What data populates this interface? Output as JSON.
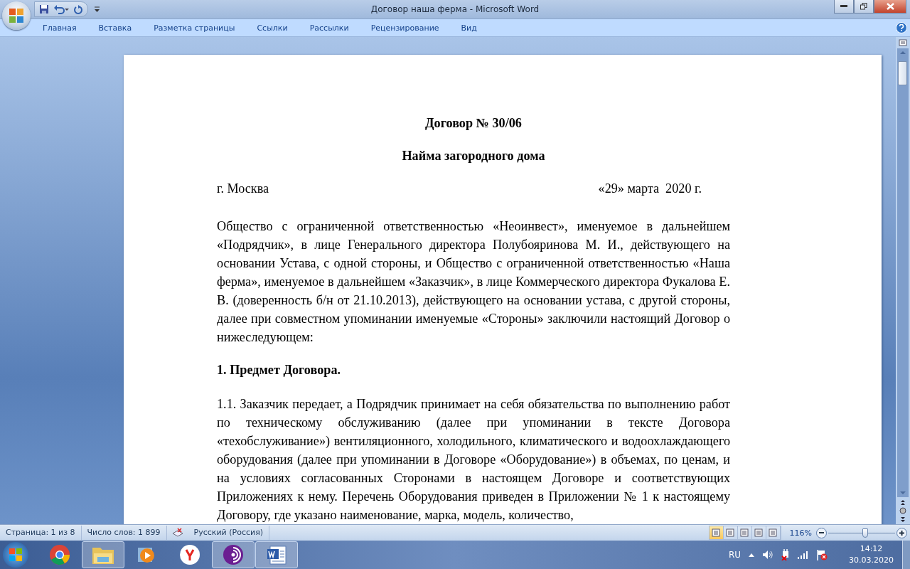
{
  "window": {
    "title": "Договор наша ферма - Microsoft Word"
  },
  "ribbon_tabs": [
    {
      "label": "Главная",
      "selected": false
    },
    {
      "label": "Вставка",
      "selected": false
    },
    {
      "label": "Разметка страницы",
      "selected": false
    },
    {
      "label": "Ссылки",
      "selected": false
    },
    {
      "label": "Рассылки",
      "selected": false
    },
    {
      "label": "Рецензирование",
      "selected": false
    },
    {
      "label": "Вид",
      "selected": false
    }
  ],
  "document": {
    "blocks": [
      {
        "kind": "title",
        "text": "Договор № 30/06"
      },
      {
        "kind": "title",
        "text": "Найма загородного дома"
      },
      {
        "kind": "dateline",
        "left": "г. Москва",
        "right": "«29» марта  2020 г."
      },
      {
        "kind": "paragraph",
        "text": "Общество с ограниченной ответственностью «Неоинвест», именуемое в дальнейшем «Подрядчик», в лице Генерального директора Полубояринова М. И., действующего на основании Устава, с одной стороны, и Общество с ограниченной ответственностью «Наша ферма», именуемое в дальнейшем «Заказчик», в лице Коммерческого директора Фукалова Е. В. (доверенность б/н от 21.10.2013), действующего на основании устава, с другой стороны, далее при совместном упоминании именуемые «Стороны» заключили настоящий Договор о нижеследующем:"
      },
      {
        "kind": "heading",
        "text": "1. Предмет Договора."
      },
      {
        "kind": "paragraph",
        "text": "1.1. Заказчик передает, а Подрядчик принимает на себя обязательства по выполнению работ по техническому обслуживанию (далее при упоминании в тексте Договора «техобслуживание») вентиляционного, холодильного, климатического и водоохлаждающего оборудования (далее при упоминании в Договоре «Оборудование») в объемах, по ценам, и на условиях согласованных Сторонами в настоящем Договоре и соответствующих Приложениях к нему. Перечень Оборудования приведен в Приложении № 1 к настоящему Договору, где указано наименование, марка, модель, количество,"
      }
    ]
  },
  "status_bar": {
    "page": "Страница: 1 из 8",
    "words": "Число слов: 1 899",
    "language": "Русский (Россия)",
    "views": [
      {
        "selected": true
      },
      {
        "selected": false
      },
      {
        "selected": false
      },
      {
        "selected": false
      },
      {
        "selected": false
      }
    ],
    "zoom": "116%",
    "zoom_slider": {
      "level": 0.55
    }
  },
  "taskbar": {
    "apps": [
      {
        "kind": "chrome",
        "selected": false
      },
      {
        "kind": "folder",
        "selected": true
      },
      {
        "kind": "media",
        "selected": false
      },
      {
        "kind": "yandex",
        "selected": false
      },
      {
        "kind": "tor",
        "selected": true
      },
      {
        "kind": "word",
        "selected": true
      }
    ],
    "language": "RU",
    "time": "14:12",
    "date": "30.03.2020"
  }
}
